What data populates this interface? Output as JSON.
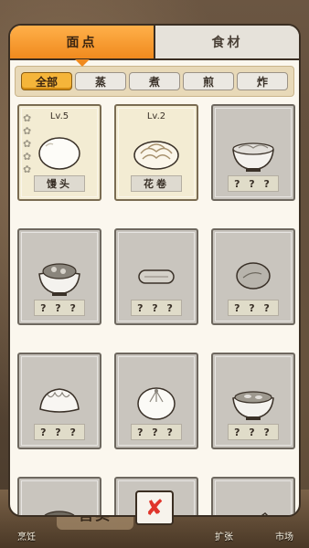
{
  "tabs": [
    {
      "label": "面点",
      "active": true
    },
    {
      "label": "食材",
      "active": false
    }
  ],
  "filters": [
    {
      "label": "全部",
      "active": true
    },
    {
      "label": "蒸",
      "active": false
    },
    {
      "label": "煮",
      "active": false
    },
    {
      "label": "煎",
      "active": false
    },
    {
      "label": "炸",
      "active": false
    }
  ],
  "items": [
    {
      "name": "馒头",
      "level": "Lv.5",
      "stars": 5,
      "unlocked": true,
      "icon": "steamed-bun-icon"
    },
    {
      "name": "花卷",
      "level": "Lv.2",
      "unlocked": true,
      "icon": "flower-roll-icon"
    },
    {
      "name": "? ? ?",
      "unlocked": false,
      "icon": "noodle-bowl-icon"
    },
    {
      "name": "? ? ?",
      "unlocked": false,
      "icon": "bowl-icon"
    },
    {
      "name": "? ? ?",
      "unlocked": false,
      "icon": "fried-dough-icon"
    },
    {
      "name": "? ? ?",
      "unlocked": false,
      "icon": "pancake-icon"
    },
    {
      "name": "? ? ?",
      "unlocked": false,
      "icon": "dumpling-icon"
    },
    {
      "name": "? ? ?",
      "unlocked": false,
      "icon": "baozi-icon"
    },
    {
      "name": "? ? ?",
      "unlocked": false,
      "icon": "soup-bowl-icon"
    },
    {
      "name": "? ? ?",
      "unlocked": false,
      "icon": "bowl-icon"
    },
    {
      "name": "? ? ?",
      "unlocked": false,
      "icon": "dumplings-plate-icon"
    },
    {
      "name": "? ? ?",
      "unlocked": false,
      "icon": "spring-roll-icon"
    }
  ],
  "bottom_nav": {
    "cook": "烹饪",
    "sell": "售卖",
    "expand": "扩张",
    "market": "市场"
  },
  "close_icon": "close-x-icon"
}
